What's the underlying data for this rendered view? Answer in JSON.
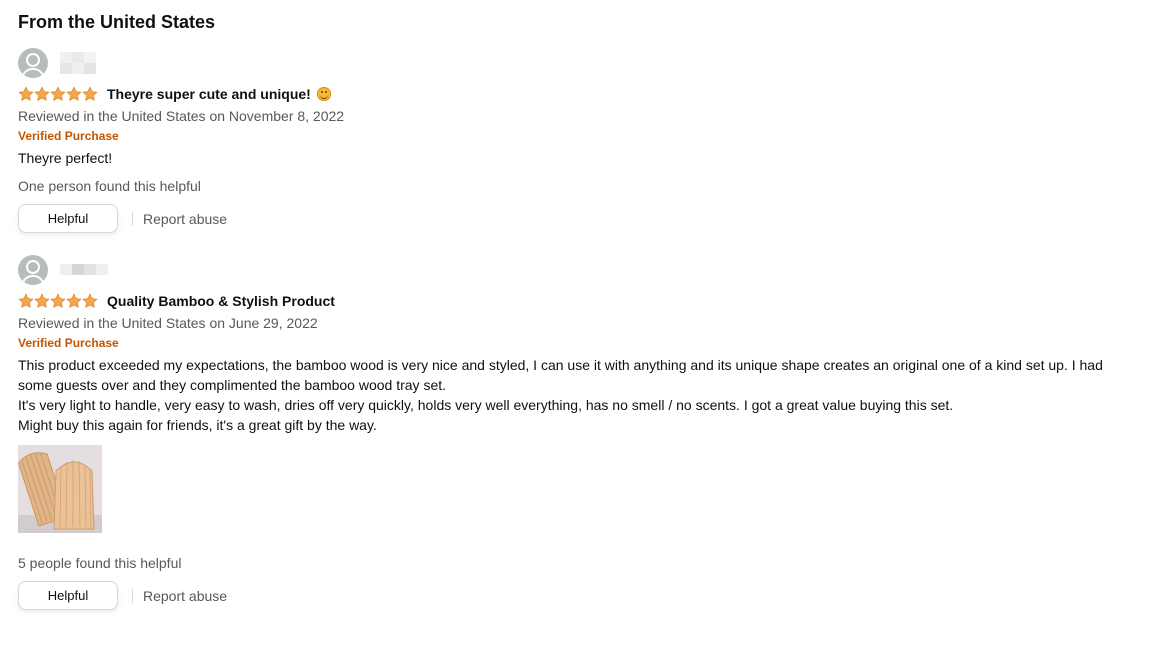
{
  "section": {
    "title": "From the United States"
  },
  "reviews": [
    {
      "rating": 5,
      "rating_max": 5,
      "title": "Theyre super cute and unique!",
      "emoji": "smiling-face-icon",
      "date": "Reviewed in the United States on November 8, 2022",
      "verified": "Verified Purchase",
      "body": [
        "Theyre perfect!"
      ],
      "helpful_count": "One person found this helpful",
      "helpful_label": "Helpful",
      "report_label": "Report abuse",
      "has_image": false
    },
    {
      "rating": 5,
      "rating_max": 5,
      "title": "Quality Bamboo & Stylish Product",
      "date": "Reviewed in the United States on June 29, 2022",
      "verified": "Verified Purchase",
      "body": [
        "This product exceeded my expectations, the bamboo wood is very nice and styled, I can use it with anything and its unique shape creates an original one of a kind set up. I had some guests over and they complimented the bamboo wood tray set.",
        "It's very light to handle, very easy to wash, dries off very quickly, holds very well everything, has no smell / no scents. I got a great value buying this set.",
        "Might buy this again for friends, it's a great gift by the way."
      ],
      "helpful_count": "5 people found this helpful",
      "helpful_label": "Helpful",
      "report_label": "Report abuse",
      "has_image": true
    }
  ],
  "colors": {
    "star": "#f3a847",
    "verified": "#c45500",
    "muted_text": "#565959",
    "text": "#0f1111",
    "avatar": "#b7bdbd"
  }
}
